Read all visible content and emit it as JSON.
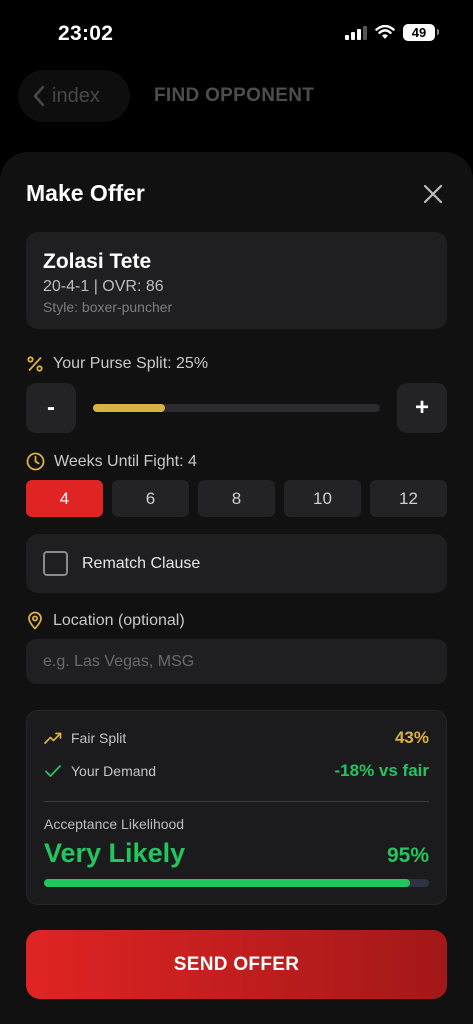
{
  "status": {
    "time": "23:02",
    "battery": "49"
  },
  "nav": {
    "back_label": "index",
    "title": "FIND OPPONENT"
  },
  "sheet": {
    "title": "Make Offer"
  },
  "opponent": {
    "name": "Zolasi Tete",
    "record": "20-4-1 | OVR: 86",
    "style": "Style: boxer-puncher"
  },
  "purse": {
    "label": "Your Purse Split: 25%",
    "value_percent": 25,
    "minus_label": "-",
    "plus_label": "+"
  },
  "weeks": {
    "label": "Weeks Until Fight: 4",
    "options": [
      "4",
      "6",
      "8",
      "10",
      "12"
    ],
    "selected": "4"
  },
  "rematch": {
    "label": "Rematch Clause"
  },
  "location": {
    "label": "Location (optional)",
    "placeholder": "e.g. Las Vegas, MSG"
  },
  "summary": {
    "fair_label": "Fair Split",
    "fair_value": "43%",
    "demand_label": "Your Demand",
    "demand_value": "-18% vs fair",
    "acceptance_label": "Acceptance Likelihood",
    "acceptance_text": "Very Likely",
    "acceptance_percent_text": "95%",
    "acceptance_percent": 95
  },
  "send_label": "SEND OFFER",
  "colors": {
    "accent_red": "#e02424",
    "gold": "#d9b144",
    "green": "#22c55e"
  }
}
